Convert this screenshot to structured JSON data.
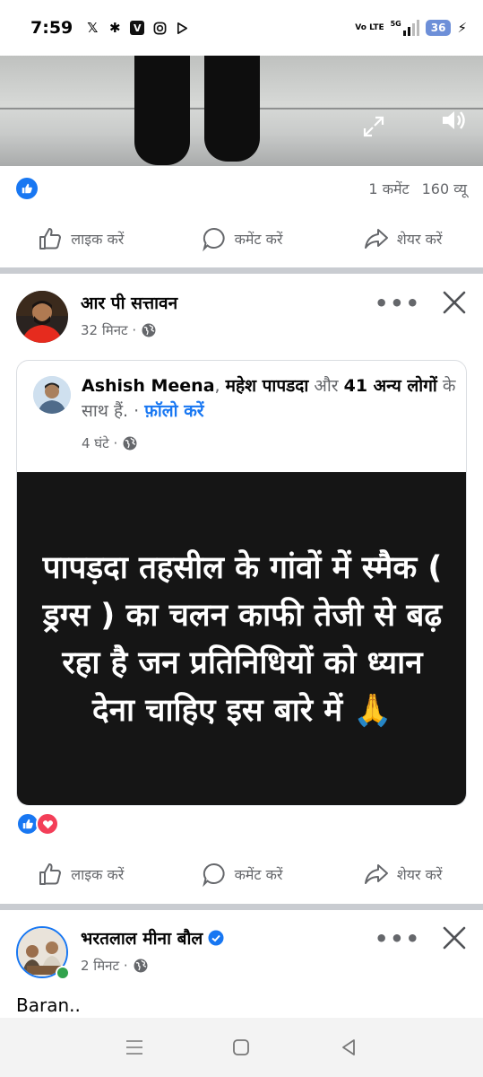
{
  "status_bar": {
    "time": "7:59",
    "icons": [
      "x-icon",
      "gear-icon",
      "v-app-icon",
      "instagram-icon",
      "play-icon"
    ],
    "network": "Vo LTE",
    "signal": "5G",
    "battery": "36"
  },
  "post1": {
    "comments": "1 कमेंट",
    "views": "160 व्यू",
    "reaction": "like-icon"
  },
  "actions": {
    "like": "लाइक करें",
    "comment": "कमेंट करें",
    "share": "शेयर करें"
  },
  "post2": {
    "author": "आर पी सत्तावन",
    "time": "32 मिनट ·",
    "shared": {
      "names": "Ashish Meena",
      "sep": ", ",
      "name2": "महेश पापडदा",
      "and": " और ",
      "others": "41 अन्य लोगों",
      "with": " के साथ हैं.",
      "dot": " · ",
      "follow": "फ़ॉलो करें",
      "time": "4 घंटे ·",
      "image_text": "पापड़दा तहसील के गांवों में स्मैक ( ड्रग्स ) का चलन काफी तेजी से बढ़ रहा है जन प्रतिनिधियों को ध्यान देना चाहिए इस बारे में 🙏"
    },
    "reactions": [
      "like-icon",
      "love-icon"
    ]
  },
  "post3": {
    "author": "भरतलाल मीना बौल",
    "time": "2 मिनट ·",
    "text": "Baran.."
  },
  "colors": {
    "facebook_blue": "#1877f2",
    "love_red": "#f33e58",
    "muted": "#65676b",
    "online_green": "#31a24c"
  }
}
